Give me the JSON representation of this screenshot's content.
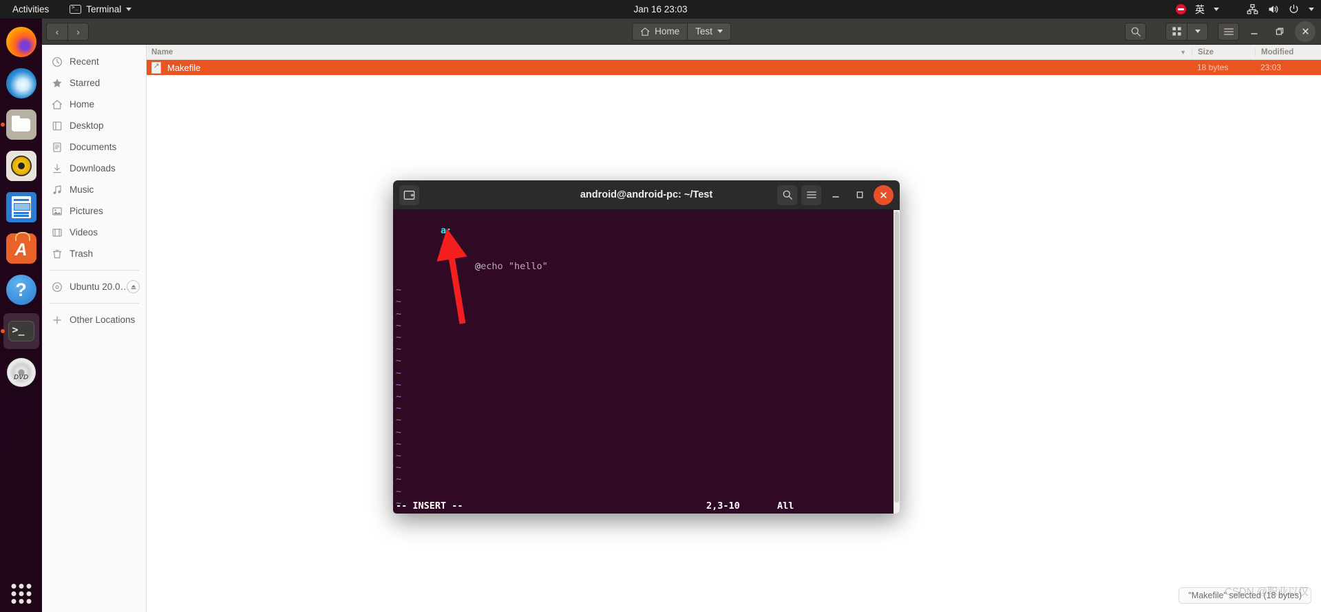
{
  "topbar": {
    "activities": "Activities",
    "app_menu": "Terminal",
    "app_icon": "terminal-icon",
    "clock": "Jan 16  23:03",
    "dnd_icon": "do-not-disturb-icon",
    "ime_label": "英",
    "network_icon": "network-icon",
    "volume_icon": "volume-icon",
    "power_icon": "power-icon",
    "menu_caret": "caret-down-icon"
  },
  "dock": {
    "items": [
      {
        "name": "firefox",
        "icon": "firefox-icon",
        "running": false
      },
      {
        "name": "thunderbird",
        "icon": "thunderbird-icon",
        "running": false
      },
      {
        "name": "files",
        "icon": "files-icon",
        "running": true
      },
      {
        "name": "rhythmbox",
        "icon": "rhythmbox-icon",
        "running": false
      },
      {
        "name": "libreoffice-impress",
        "icon": "impress-icon",
        "running": false
      },
      {
        "name": "ubuntu-software",
        "icon": "software-icon",
        "running": false,
        "letter": "A"
      },
      {
        "name": "help",
        "icon": "help-icon",
        "running": false,
        "letter": "?"
      },
      {
        "name": "terminal",
        "icon": "terminal-icon",
        "running": true,
        "glyph": ">_"
      },
      {
        "name": "ubuntu-dvd",
        "icon": "dvd-icon",
        "running": false,
        "label": "DVD"
      }
    ],
    "show_apps": "show-applications-icon"
  },
  "files_window": {
    "nav": {
      "back": "‹",
      "forward": "›"
    },
    "breadcrumbs": [
      {
        "label": "Home",
        "icon": "home-icon",
        "active": false
      },
      {
        "label": "Test",
        "icon": "",
        "active": true,
        "caret": "caret-down-icon"
      }
    ],
    "header_buttons": {
      "search": "search-icon",
      "view_grid": "grid-view-icon",
      "view_caret": "caret-down-icon",
      "menu": "hamburger-menu-icon",
      "minimize": "minimize-icon",
      "maximize": "restore-icon",
      "close": "close-icon"
    },
    "sidebar": [
      {
        "label": "Recent",
        "icon": "clock-icon"
      },
      {
        "label": "Starred",
        "icon": "star-icon"
      },
      {
        "label": "Home",
        "icon": "home-icon"
      },
      {
        "label": "Desktop",
        "icon": "desktop-icon"
      },
      {
        "label": "Documents",
        "icon": "documents-icon"
      },
      {
        "label": "Downloads",
        "icon": "download-icon"
      },
      {
        "label": "Music",
        "icon": "music-icon"
      },
      {
        "label": "Pictures",
        "icon": "picture-icon"
      },
      {
        "label": "Videos",
        "icon": "video-icon"
      },
      {
        "label": "Trash",
        "icon": "trash-icon"
      }
    ],
    "devices": [
      {
        "label": "Ubuntu 20.0…",
        "icon": "disc-icon",
        "eject": "eject-icon"
      }
    ],
    "other_locations": {
      "label": "Other Locations",
      "icon": "plus-icon"
    },
    "columns": {
      "name": "Name",
      "size": "Size",
      "modified": "Modified",
      "sort_icon": "sort-descending-icon"
    },
    "rows": [
      {
        "name": "Makefile",
        "icon": "text-file-icon",
        "size": "18 bytes",
        "modified": "23:03",
        "selected": true
      }
    ],
    "status": "\"Makefile\" selected (18 bytes)",
    "watermark": "CSDN @职业以仅"
  },
  "terminal_window": {
    "title": "android@android-pc: ~/Test",
    "buttons": {
      "new_tab": "new-tab-icon",
      "search": "search-icon",
      "menu": "hamburger-menu-icon",
      "minimize": "minimize-icon",
      "maximize": "maximize-icon",
      "close": "close-icon"
    },
    "editor": {
      "target_line": "a:",
      "recipe_prefix": "@",
      "recipe_cmd": "echo ",
      "recipe_arg": "\"hello\"",
      "tilde_char": "~",
      "tilde_count": 19,
      "status_mode": "-- INSERT --",
      "status_position": "2,3-10",
      "status_scroll": "All"
    },
    "annotation": {
      "type": "arrow",
      "color": "#f41f1f"
    }
  }
}
